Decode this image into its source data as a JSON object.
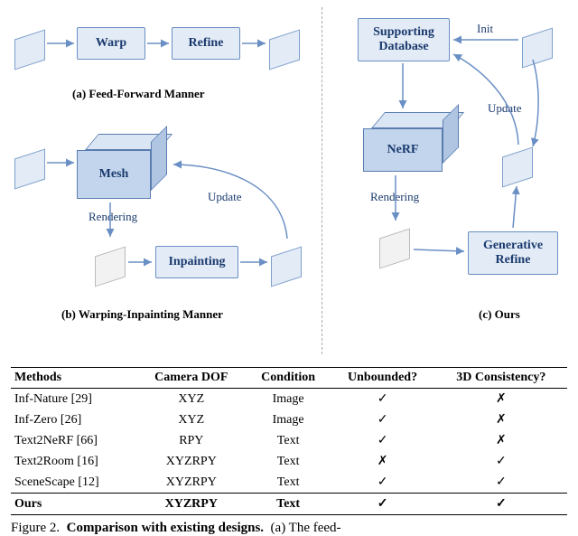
{
  "diagram": {
    "a": {
      "warp": "Warp",
      "refine": "Refine",
      "caption": "(a) Feed-Forward Manner"
    },
    "b": {
      "mesh": "Mesh",
      "inpainting": "Inpainting",
      "rendering": "Rendering",
      "update": "Update",
      "caption": "(b) Warping-Inpainting Manner"
    },
    "c": {
      "supporting_database": "Supporting\nDatabase",
      "nerf": "NeRF",
      "generative_refine": "Generative\nRefine",
      "rendering": "Rendering",
      "init": "Init",
      "update": "Update",
      "caption": "(c) Ours"
    }
  },
  "table": {
    "headers": [
      "Methods",
      "Camera DOF",
      "Condition",
      "Unbounded?",
      "3D Consistency?"
    ],
    "rows": [
      {
        "method": "Inf-Nature [29]",
        "dof": "XYZ",
        "cond": "Image",
        "unb": "✓",
        "cons": "✗"
      },
      {
        "method": "Inf-Zero [26]",
        "dof": "XYZ",
        "cond": "Image",
        "unb": "✓",
        "cons": "✗"
      },
      {
        "method": "Text2NeRF [66]",
        "dof": "RPY",
        "cond": "Text",
        "unb": "✓",
        "cons": "✗"
      },
      {
        "method": "Text2Room [16]",
        "dof": "XYZRPY",
        "cond": "Text",
        "unb": "✗",
        "cons": "✓"
      },
      {
        "method": "SceneScape [12]",
        "dof": "XYZRPY",
        "cond": "Text",
        "unb": "✓",
        "cons": "✓"
      },
      {
        "method": "Ours",
        "dof": "XYZRPY",
        "cond": "Text",
        "unb": "✓",
        "cons": "✓",
        "bold": true
      }
    ]
  },
  "figure_caption_prefix": "Figure 2.",
  "figure_caption_bold": "Comparison with existing designs.",
  "figure_caption_tail": "(a) The feed-",
  "chart_data": {
    "type": "table",
    "title": "Comparison with existing designs",
    "columns": [
      "Methods",
      "Camera DOF",
      "Condition",
      "Unbounded?",
      "3D Consistency?"
    ],
    "rows": [
      [
        "Inf-Nature [29]",
        "XYZ",
        "Image",
        true,
        false
      ],
      [
        "Inf-Zero [26]",
        "XYZ",
        "Image",
        true,
        false
      ],
      [
        "Text2NeRF [66]",
        "RPY",
        "Text",
        true,
        false
      ],
      [
        "Text2Room [16]",
        "XYZRPY",
        "Text",
        false,
        true
      ],
      [
        "SceneScape [12]",
        "XYZRPY",
        "Text",
        true,
        true
      ],
      [
        "Ours",
        "XYZRPY",
        "Text",
        true,
        true
      ]
    ]
  }
}
